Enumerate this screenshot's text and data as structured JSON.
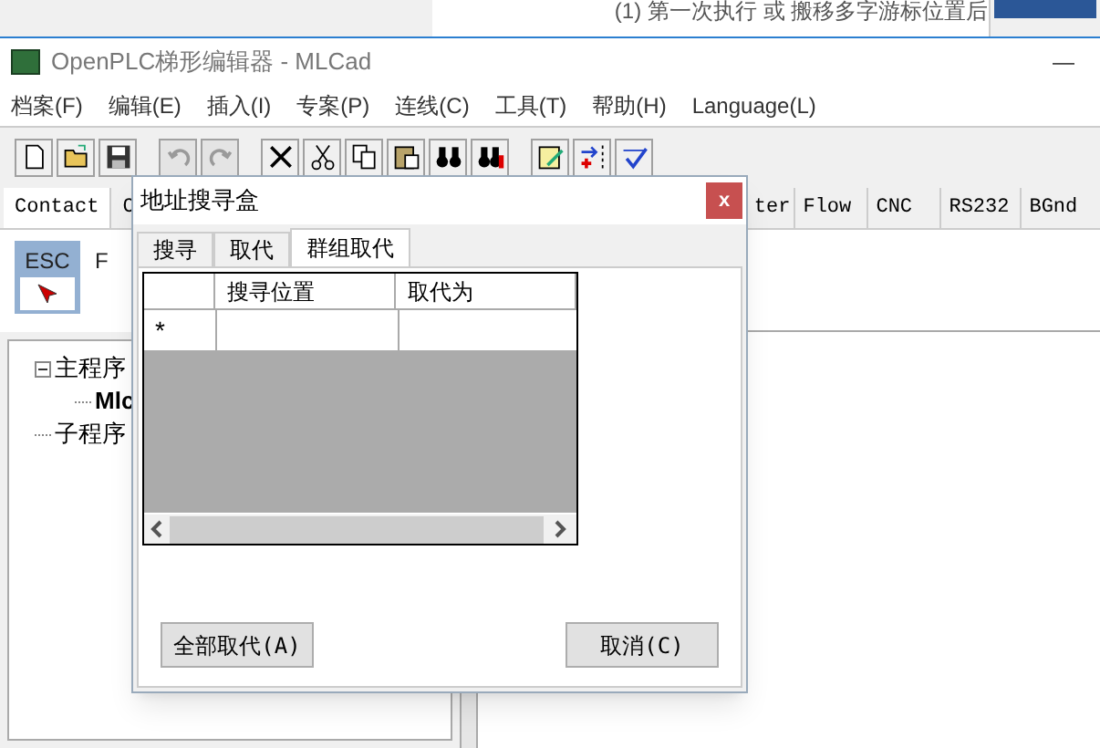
{
  "background_window": {
    "text": "(1) 第一次执行 或 搬移多字游标位置后"
  },
  "window": {
    "title": "OpenPLC梯形编辑器 - MLCad",
    "minimize": "—"
  },
  "menu": [
    "档案(F)",
    "编辑(E)",
    "插入(I)",
    "专案(P)",
    "连线(C)",
    "工具(T)",
    "帮助(H)",
    "Language(L)"
  ],
  "toolbar": [
    {
      "kind": "new",
      "disabled": false
    },
    {
      "kind": "open",
      "disabled": false
    },
    {
      "kind": "save",
      "disabled": false
    },
    {
      "kind": "undo",
      "disabled": true
    },
    {
      "kind": "redo",
      "disabled": true
    },
    {
      "kind": "delete",
      "disabled": false
    },
    {
      "kind": "cut",
      "disabled": false
    },
    {
      "kind": "copy",
      "disabled": false
    },
    {
      "kind": "paste",
      "disabled": false
    },
    {
      "kind": "find",
      "disabled": false
    },
    {
      "kind": "findnext",
      "disabled": false
    },
    {
      "kind": "edit",
      "disabled": false
    },
    {
      "kind": "insert",
      "disabled": false
    },
    {
      "kind": "check",
      "disabled": false
    }
  ],
  "element_tabs": [
    {
      "label": "Contact",
      "selected": true
    },
    {
      "label": "C",
      "selected": false
    },
    {
      "label": "ter",
      "selected": false
    },
    {
      "label": "Flow",
      "selected": false
    },
    {
      "label": "CNC",
      "selected": false
    },
    {
      "label": "RS232",
      "selected": false
    },
    {
      "label": "BGnd",
      "selected": false
    }
  ],
  "palette": {
    "esc": "ESC",
    "f": "F"
  },
  "tree": [
    {
      "label": "主程序",
      "expanded": true,
      "children": [
        {
          "label": "Mlc"
        }
      ]
    },
    {
      "label": "子程序"
    }
  ],
  "dialog": {
    "title": "地址搜寻盒",
    "close": "x",
    "tabs": [
      {
        "label": "搜寻",
        "selected": false
      },
      {
        "label": "取代",
        "selected": false
      },
      {
        "label": "群组取代",
        "selected": true
      }
    ],
    "grid": {
      "columns": [
        "搜寻位置",
        "取代为"
      ],
      "new_row_marker": "*"
    },
    "buttons": [
      "全部取代(A)",
      "取消(C)"
    ]
  }
}
